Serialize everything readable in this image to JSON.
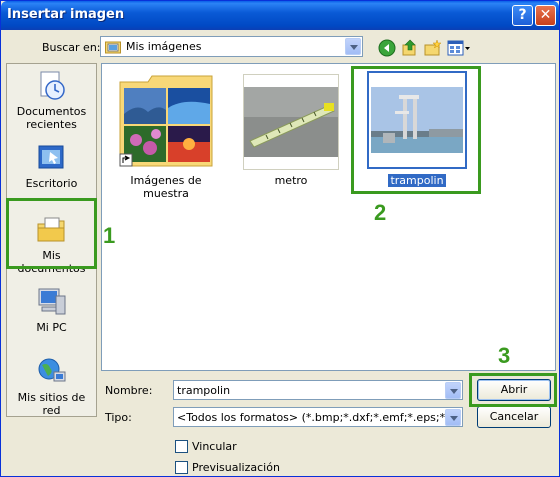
{
  "window": {
    "title": "Insertar imagen"
  },
  "lookin": {
    "label": "Buscar en:",
    "value": "Mis imágenes"
  },
  "places": [
    {
      "label": "Documentos recientes"
    },
    {
      "label": "Escritorio"
    },
    {
      "label": "Mis documentos"
    },
    {
      "label": "Mi PC"
    },
    {
      "label": "Mis sitios de red"
    }
  ],
  "files": [
    {
      "label": "Imágenes de muestra"
    },
    {
      "label": "metro"
    },
    {
      "label": "trampolin",
      "selected": true
    }
  ],
  "filename": {
    "label": "Nombre:",
    "value": "trampolin"
  },
  "filetype": {
    "label": "Tipo:",
    "value": "<Todos los formatos> (*.bmp;*.dxf;*.emf;*.eps;*.gif;*.jpg;*.j"
  },
  "options": {
    "link_label": "Vincular",
    "preview_label": "Previsualización"
  },
  "buttons": {
    "open_label": "Abrir",
    "cancel_label": "Cancelar"
  },
  "annotations": {
    "step1": "1",
    "step2": "2",
    "step3": "3"
  },
  "colors": {
    "highlight": "#3a9a1f",
    "selection": "#316ac5"
  }
}
